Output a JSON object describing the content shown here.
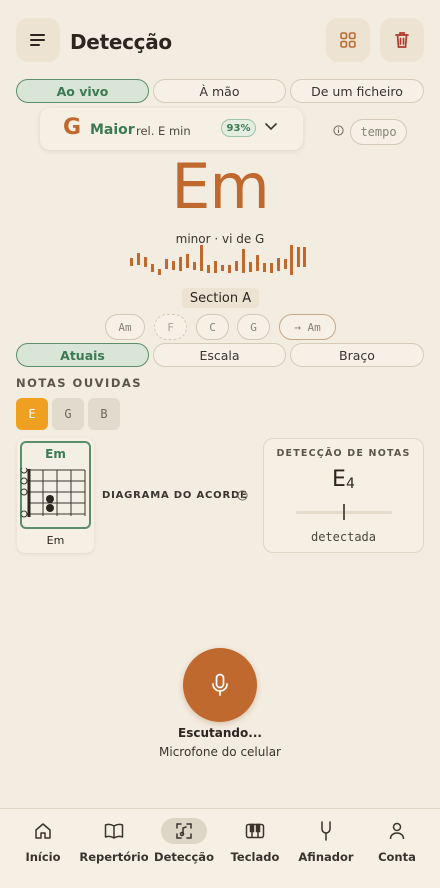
{
  "header": {
    "title": "Detecção"
  },
  "source_tabs": [
    {
      "label": "Ao vivo",
      "active": true
    },
    {
      "label": "À mão",
      "active": false
    },
    {
      "label": "De um ficheiro",
      "active": false
    }
  ],
  "key": {
    "note": "G",
    "mode": "Maior",
    "relative": "rel. E min",
    "confidence": "93%"
  },
  "tempo_label": "tempo",
  "chord": {
    "name": "Em",
    "description": "minor · vi de G"
  },
  "section_label": "Section A",
  "progression": [
    "Am",
    "F",
    "C",
    "G",
    "→ Am"
  ],
  "view_tabs": [
    {
      "label": "Atuais",
      "active": true
    },
    {
      "label": "Escala",
      "active": false
    },
    {
      "label": "Braço",
      "active": false
    }
  ],
  "notes_heard": {
    "title": "NOTAS OUVIDAS",
    "notes": [
      "E",
      "G",
      "B"
    ]
  },
  "chord_diagram": {
    "name": "Em",
    "caption": "Em",
    "label": "DIAGRAMA DO ACORDE"
  },
  "note_detection": {
    "title": "DETECÇÃO DE NOTAS",
    "note": "E",
    "octave": "4",
    "status": "detectada"
  },
  "listening": {
    "status": "Escutando...",
    "source": "Microfone do celular"
  },
  "bottom_nav": [
    {
      "label": "Início",
      "icon": "home-icon",
      "active": false
    },
    {
      "label": "Repertório",
      "icon": "book-icon",
      "active": false
    },
    {
      "label": "Detecção",
      "icon": "detect-icon",
      "active": true
    },
    {
      "label": "Teclado",
      "icon": "piano-icon",
      "active": false
    },
    {
      "label": "Afinador",
      "icon": "tuning-fork-icon",
      "active": false
    },
    {
      "label": "Conta",
      "icon": "user-icon",
      "active": false
    }
  ],
  "colors": {
    "background": "#f3ece0",
    "accent_orange": "#c0692f",
    "accent_green": "#3b7a52",
    "active_note": "#f0a020",
    "delete_red": "#b03a2e"
  }
}
